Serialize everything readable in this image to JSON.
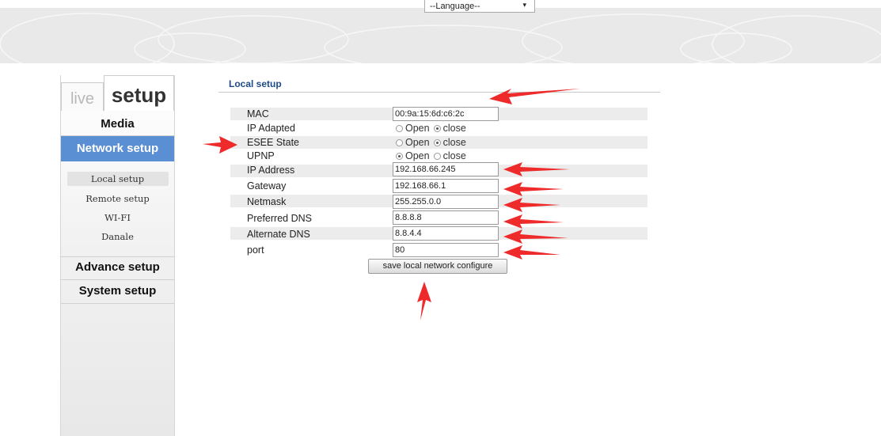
{
  "header": {
    "language_label": "--Language--",
    "caret": "▾"
  },
  "tabs": {
    "live": "live",
    "setup": "setup"
  },
  "sidebar": {
    "items": [
      "Media",
      "Network setup",
      "Advance setup",
      "System setup"
    ],
    "active_item": "Network setup",
    "sub_items": [
      "Local setup",
      "Remote setup",
      "WI-FI",
      "Danale"
    ],
    "active_sub_item": "Local setup"
  },
  "main": {
    "section_title": "Local setup",
    "fields": {
      "mac": {
        "label": "MAC",
        "value": "00:9a:15:6d:c6:2c"
      },
      "ip_adapted": {
        "label": "IP Adapted",
        "option_open": "Open",
        "option_close": "close",
        "selected": "close"
      },
      "esee_state": {
        "label": "ESEE State",
        "option_open": "Open",
        "option_close": "close",
        "selected": "close"
      },
      "upnp": {
        "label": "UPNP",
        "option_open": "Open",
        "option_close": "close",
        "selected": "Open"
      },
      "ip_address": {
        "label": "IP Address",
        "value": "192.168.66.245"
      },
      "gateway": {
        "label": "Gateway",
        "value": "192.168.66.1"
      },
      "netmask": {
        "label": "Netmask",
        "value": "255.255.0.0"
      },
      "preferred_dns": {
        "label": "Preferred DNS",
        "value": "8.8.8.8"
      },
      "alternate_dns": {
        "label": "Alternate DNS",
        "value": "8.8.4.4"
      },
      "port": {
        "label": "port",
        "value": "80"
      }
    },
    "save_button": "save local network configure"
  },
  "colors": {
    "accent": "#5b8fd3",
    "title": "#1f4a8a",
    "annotation_arrow": "#ee2a2a"
  }
}
